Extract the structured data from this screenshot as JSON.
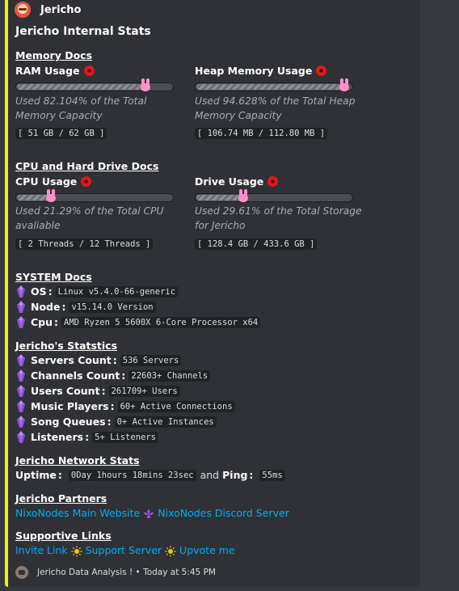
{
  "author": {
    "name": "Jericho"
  },
  "title": "Jericho Internal Stats",
  "memory": {
    "section_title": "Memory Docs",
    "ram": {
      "label": "RAM Usage",
      "percent": 82.104,
      "desc": "Used 82.104% of the Total Memory Capacity",
      "code": "[ 51 GB / 62 GB ]"
    },
    "heap": {
      "label": "Heap Memory Usage",
      "percent": 94.628,
      "desc": "Used 94.628% of the Total Heap Memory Capacity",
      "code": "[ 106.74 MB / 112.80 MB ]"
    }
  },
  "cpu": {
    "section_title": "CPU and Hard Drive Docs",
    "cpu": {
      "label": "CPU Usage",
      "percent": 21.29,
      "desc": "Used 21.29% of the Total CPU avaliable",
      "code": "[ 2 Threads / 12 Threads ]"
    },
    "drive": {
      "label": "Drive Usage",
      "percent": 29.61,
      "desc": "Used 29.61% of the Total Storage for Jericho",
      "code": "[ 128.4 GB / 433.6 GB ]"
    }
  },
  "system": {
    "section_title": "SYSTEM Docs",
    "items": [
      {
        "key": "OS",
        "value": "Linux v5.4.0-66-generic"
      },
      {
        "key": "Node",
        "value": "v15.14.0 Version"
      },
      {
        "key": "Cpu",
        "value": "AMD Ryzen 5 5600X 6-Core Processor x64"
      }
    ]
  },
  "stats": {
    "section_title": "Jericho's Statstics",
    "items": [
      {
        "key": "Servers Count",
        "value": "536 Servers"
      },
      {
        "key": "Channels Count",
        "value": "22603+ Channels"
      },
      {
        "key": "Users Count",
        "value": "261709+ Users"
      },
      {
        "key": "Music Players",
        "value": "60+ Active Connections"
      },
      {
        "key": "Song Queues",
        "value": "0+ Active Instances"
      },
      {
        "key": "Listeners",
        "value": "5+ Listeners"
      }
    ]
  },
  "network": {
    "section_title": "Jericho Network Stats",
    "uptime_label": "Uptime",
    "uptime_value": "0Day 1hours 18mins 23sec",
    "and_text": "and",
    "ping_label": "Ping",
    "ping_value": "55ms"
  },
  "partners": {
    "section_title": "Jericho Partners",
    "links": [
      "NixoNodes Main Website",
      "NixoNodes Discord Server"
    ]
  },
  "supportive": {
    "section_title": "Supportive Links",
    "links": [
      "Invite Link",
      "Support Server",
      "Upvote me"
    ]
  },
  "footer": {
    "text": "Jericho Data Analysis ! • Today at 5:45 PM"
  },
  "colors": {
    "accent_bar": "#f1f500",
    "link": "#00aff4",
    "bunny": "#ff8fc8",
    "gem": "#9b5de5"
  },
  "icons": {
    "usage": "red-orb-icon",
    "bullet": "purple-crystal-icon",
    "partner_sep": "fleur-de-lis-icon",
    "support_sep": "sun-icon"
  }
}
